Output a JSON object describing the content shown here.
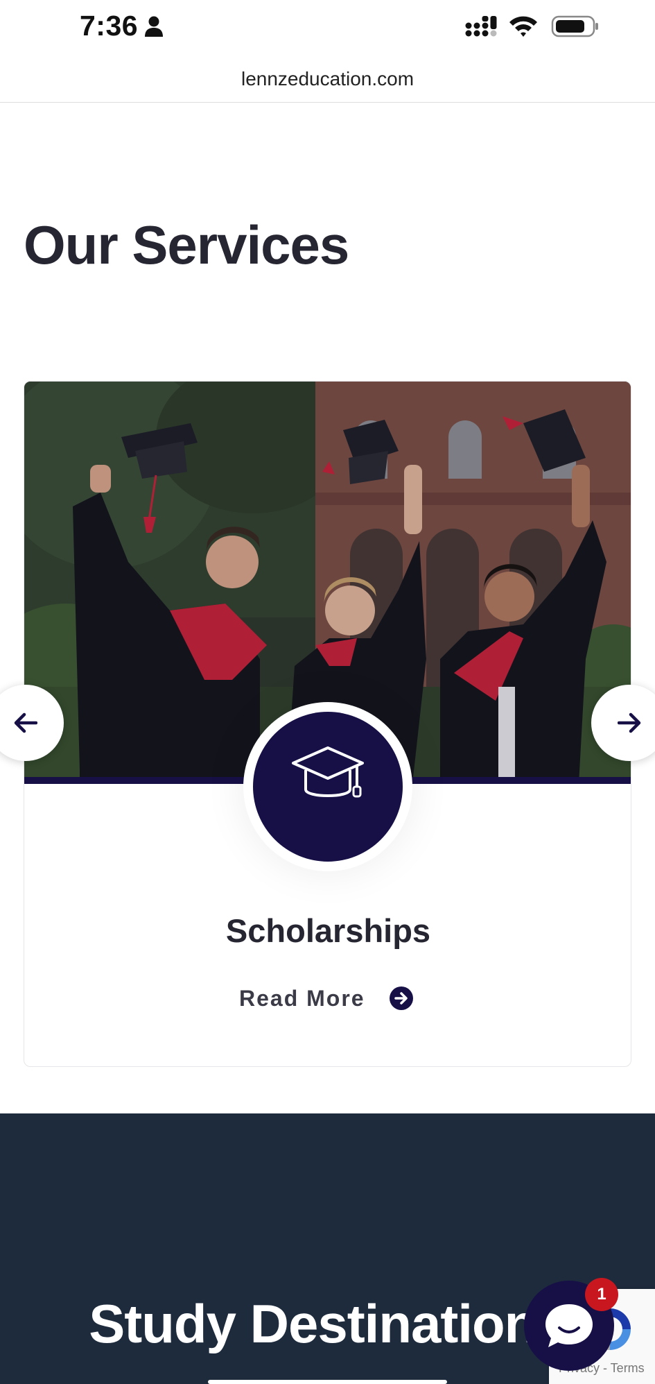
{
  "status_bar": {
    "time": "7:36",
    "icons": [
      "person-icon",
      "signal-icon",
      "wifi-icon",
      "battery-icon"
    ]
  },
  "browser": {
    "url": "lennzeducation.com"
  },
  "services": {
    "title": "Our Services",
    "card": {
      "photo": "graduates-throwing-caps-photo",
      "icon": "graduation-cap-icon",
      "title": "Scholarships",
      "read_more_label": "Read More",
      "read_more_icon": "arrow-circle-right-icon"
    },
    "prev_icon": "arrow-left-icon",
    "next_icon": "arrow-right-icon"
  },
  "destinations": {
    "title": "Study Destinations"
  },
  "chat": {
    "badge_count": "1",
    "icon": "chat-bubble-icon"
  },
  "recaptcha": {
    "text": "Privacy - Terms"
  },
  "colors": {
    "brand_navy": "#161047",
    "dark_section": "#1e2b3d",
    "badge_red": "#c8171f",
    "heading": "#262632"
  }
}
